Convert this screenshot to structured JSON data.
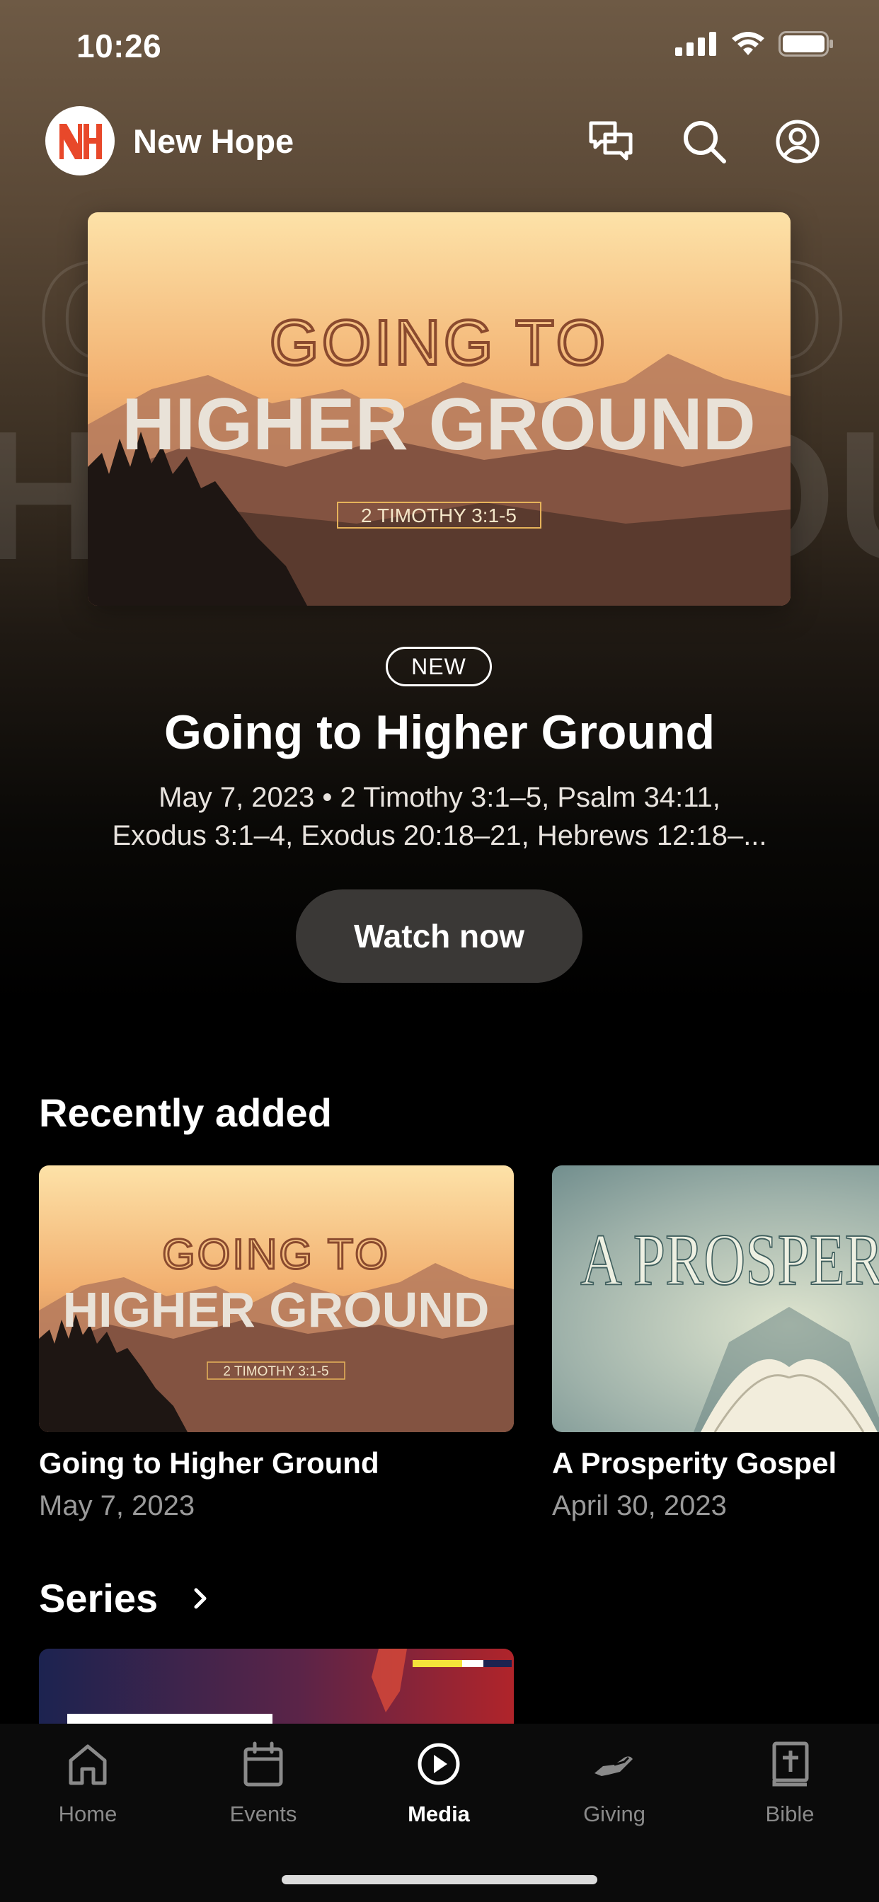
{
  "status_bar": {
    "time": "10:26"
  },
  "header": {
    "brand_name": "New Hope",
    "logo_text": "NH"
  },
  "hero": {
    "artwork": {
      "line1": "GOING TO",
      "line2": "HIGHER GROUND",
      "scripture": "2 TIMOTHY 3:1-5"
    },
    "badge": "NEW",
    "title": "Going to Higher Ground",
    "meta_line1": "May 7, 2023 • 2 Timothy 3:1–5, Psalm 34:11,",
    "meta_line2": "Exodus 3:1–4, Exodus 20:18–21, Hebrews 12:18–...",
    "watch_button": "Watch now"
  },
  "recently_added": {
    "title": "Recently added",
    "items": [
      {
        "title": "Going to Higher Ground",
        "date": "May 7, 2023",
        "artwork": {
          "line1": "GOING TO",
          "line2": "HIGHER GROUND",
          "scripture": "2 TIMOTHY 3:1-5"
        }
      },
      {
        "title": "A Prosperity Gospel",
        "date": "April 30, 2023",
        "artwork": {
          "text": "A PROSPERITY G"
        }
      }
    ]
  },
  "series": {
    "title": "Series"
  },
  "tab_bar": {
    "tabs": [
      {
        "label": "Home",
        "icon": "home-icon"
      },
      {
        "label": "Events",
        "icon": "calendar-icon"
      },
      {
        "label": "Media",
        "icon": "play-circle-icon",
        "active": true
      },
      {
        "label": "Giving",
        "icon": "giving-hand-icon"
      },
      {
        "label": "Bible",
        "icon": "bible-icon"
      }
    ]
  },
  "colors": {
    "logo_red": "#e8482a",
    "accent_gold": "#e6b35a",
    "button_bg": "#3a3836"
  }
}
